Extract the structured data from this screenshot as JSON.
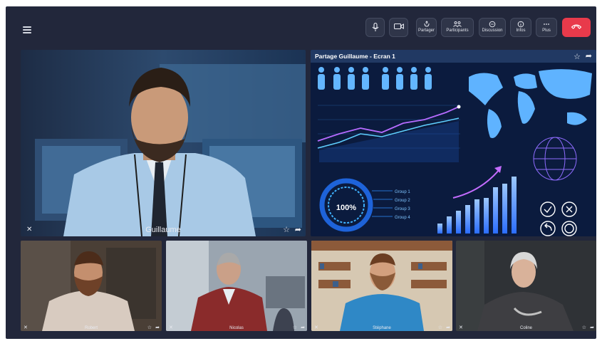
{
  "toolbar": {
    "partager": "Partager",
    "participants": "Participants",
    "discussion": "Discussion",
    "infos": "Infos",
    "plus": "Plus"
  },
  "main_video": {
    "name": "Guillaume"
  },
  "share": {
    "title": "Partage Guillaume - Ecran 1",
    "percent": "100%",
    "groups": [
      "Group 1",
      "Group 2",
      "Group 3",
      "Group 4"
    ]
  },
  "participants": [
    {
      "name": "Robert"
    },
    {
      "name": "Nicolas"
    },
    {
      "name": "Stéphane"
    },
    {
      "name": "Coline"
    }
  ],
  "colors": {
    "background": "#22273b",
    "end_call": "#e83a4b",
    "share_bg": "#0b1b3e",
    "accent": "#2ea6ff"
  }
}
